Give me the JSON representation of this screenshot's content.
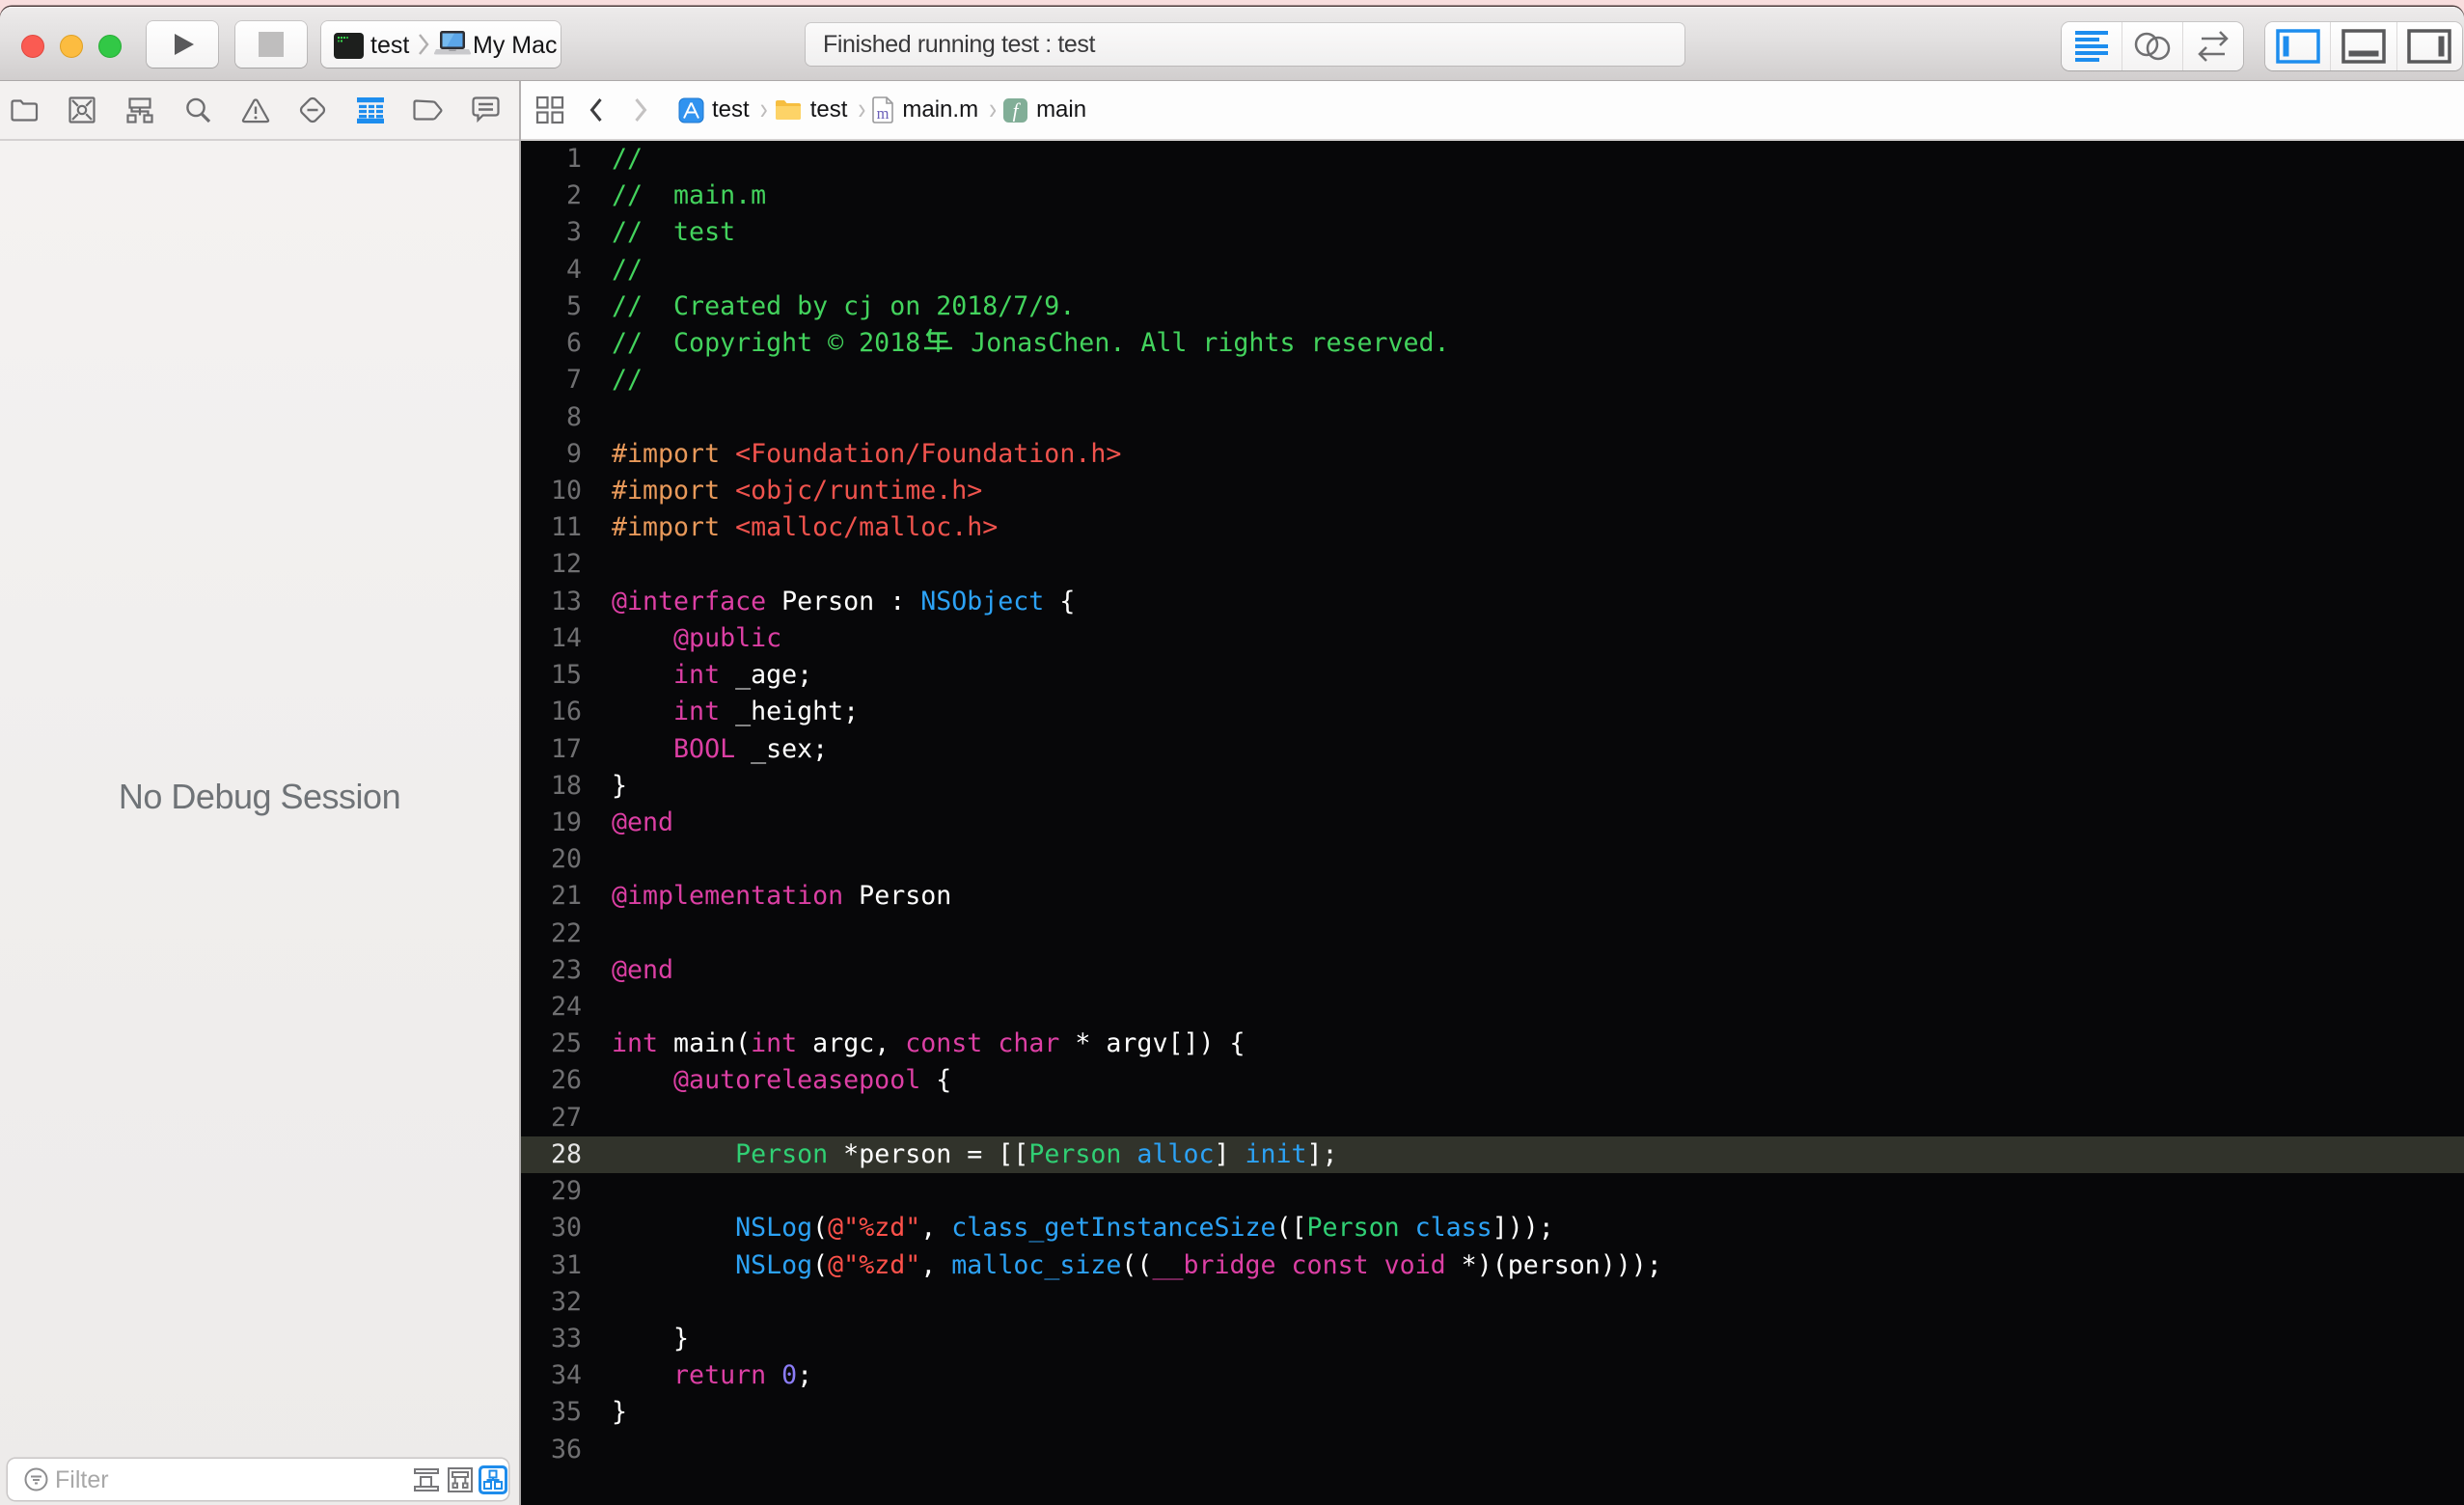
{
  "toolbar": {
    "traffic_lights": [
      "close",
      "minimize",
      "zoom"
    ],
    "run_button": "run",
    "stop_button": "stop",
    "scheme": {
      "name": "test",
      "destination": "My Mac",
      "scheme_icon": "terminal-app-icon",
      "destination_icon": "laptop-icon"
    },
    "status": "Finished running test : test",
    "editor_modes": [
      "standard-editor-icon",
      "assistant-editor-icon",
      "version-editor-icon"
    ],
    "editor_mode_active": 0,
    "panel_toggles": [
      "navigator-panel-icon",
      "debug-area-icon",
      "inspector-panel-icon"
    ],
    "panel_toggles_active": [
      0
    ]
  },
  "navigator_bar": {
    "icons": [
      "project-navigator-icon",
      "source-control-icon",
      "symbol-navigator-icon",
      "find-navigator-icon",
      "issue-navigator-icon",
      "test-navigator-icon",
      "debug-navigator-icon",
      "breakpoint-navigator-icon",
      "report-navigator-icon"
    ],
    "active_index": 6
  },
  "jump_bar": {
    "related_items_icon": "related-items-icon",
    "back": "‹",
    "forward": "›",
    "separator": "›",
    "breadcrumb": [
      {
        "icon": "project-icon",
        "label": "test"
      },
      {
        "icon": "folder-icon",
        "label": "test"
      },
      {
        "icon": "objc-file-icon",
        "label": "main.m"
      },
      {
        "icon": "function-icon",
        "label": "main"
      }
    ]
  },
  "sidebar": {
    "empty_message": "No Debug Session",
    "filter_placeholder": "Filter",
    "filter_icon": "filter-icon",
    "view_buttons": [
      "view-by-thread-icon",
      "view-by-queue-icon",
      "view-hierarchy-icon"
    ],
    "view_buttons_active": 2
  },
  "editor": {
    "language": "objective-c",
    "current_line": 28,
    "colors": {
      "c": "#43D35D",
      "p": "#E8995A",
      "h": "#F0534D",
      "k": "#DC3FA4",
      "t": "#FFFFFF",
      "b": "#2CA2F5",
      "g": "#30D074",
      "s": "#FF514A",
      "n": "#8B7CF6"
    },
    "lines": [
      {
        "n": 1,
        "tokens": [
          [
            "//",
            "c"
          ]
        ]
      },
      {
        "n": 2,
        "tokens": [
          [
            "//  main.m",
            "c"
          ]
        ]
      },
      {
        "n": 3,
        "tokens": [
          [
            "//  test",
            "c"
          ]
        ]
      },
      {
        "n": 4,
        "tokens": [
          [
            "//",
            "c"
          ]
        ]
      },
      {
        "n": 5,
        "tokens": [
          [
            "//  Created by cj on 2018/7/9.",
            "c"
          ]
        ]
      },
      {
        "n": 6,
        "tokens": [
          [
            "//  Copyright © 2018年 JonasChen. All rights reserved.",
            "c"
          ]
        ]
      },
      {
        "n": 7,
        "tokens": [
          [
            "//",
            "c"
          ]
        ]
      },
      {
        "n": 8,
        "tokens": []
      },
      {
        "n": 9,
        "tokens": [
          [
            "#import",
            "p"
          ],
          [
            " ",
            "t"
          ],
          [
            "<Foundation/Foundation.h>",
            "h"
          ]
        ]
      },
      {
        "n": 10,
        "tokens": [
          [
            "#import",
            "p"
          ],
          [
            " ",
            "t"
          ],
          [
            "<objc/runtime.h>",
            "h"
          ]
        ]
      },
      {
        "n": 11,
        "tokens": [
          [
            "#import",
            "p"
          ],
          [
            " ",
            "t"
          ],
          [
            "<malloc/malloc.h>",
            "h"
          ]
        ]
      },
      {
        "n": 12,
        "tokens": []
      },
      {
        "n": 13,
        "tokens": [
          [
            "@interface",
            "k"
          ],
          [
            " Person : ",
            "t"
          ],
          [
            "NSObject",
            "b"
          ],
          [
            " {",
            "t"
          ]
        ]
      },
      {
        "n": 14,
        "tokens": [
          [
            "    ",
            "t"
          ],
          [
            "@public",
            "k"
          ]
        ]
      },
      {
        "n": 15,
        "tokens": [
          [
            "    ",
            "t"
          ],
          [
            "int",
            "k"
          ],
          [
            " _age;",
            "t"
          ]
        ]
      },
      {
        "n": 16,
        "tokens": [
          [
            "    ",
            "t"
          ],
          [
            "int",
            "k"
          ],
          [
            " _height;",
            "t"
          ]
        ]
      },
      {
        "n": 17,
        "tokens": [
          [
            "    ",
            "t"
          ],
          [
            "BOOL",
            "k"
          ],
          [
            " _sex;",
            "t"
          ]
        ]
      },
      {
        "n": 18,
        "tokens": [
          [
            "}",
            "t"
          ]
        ]
      },
      {
        "n": 19,
        "tokens": [
          [
            "@end",
            "k"
          ]
        ]
      },
      {
        "n": 20,
        "tokens": []
      },
      {
        "n": 21,
        "tokens": [
          [
            "@implementation",
            "k"
          ],
          [
            " Person",
            "t"
          ]
        ]
      },
      {
        "n": 22,
        "tokens": []
      },
      {
        "n": 23,
        "tokens": [
          [
            "@end",
            "k"
          ]
        ]
      },
      {
        "n": 24,
        "tokens": []
      },
      {
        "n": 25,
        "tokens": [
          [
            "int",
            "k"
          ],
          [
            " main(",
            "t"
          ],
          [
            "int",
            "k"
          ],
          [
            " argc, ",
            "t"
          ],
          [
            "const",
            "k"
          ],
          [
            " ",
            "t"
          ],
          [
            "char",
            "k"
          ],
          [
            " * argv[]) {",
            "t"
          ]
        ]
      },
      {
        "n": 26,
        "tokens": [
          [
            "    ",
            "t"
          ],
          [
            "@autoreleasepool",
            "k"
          ],
          [
            " {",
            "t"
          ]
        ]
      },
      {
        "n": 27,
        "tokens": []
      },
      {
        "n": 28,
        "tokens": [
          [
            "        ",
            "t"
          ],
          [
            "Person",
            "g"
          ],
          [
            " *person = [[",
            "t"
          ],
          [
            "Person",
            "g"
          ],
          [
            " ",
            "t"
          ],
          [
            "alloc",
            "b"
          ],
          [
            "] ",
            "t"
          ],
          [
            "init",
            "b"
          ],
          [
            "];",
            "t"
          ]
        ]
      },
      {
        "n": 29,
        "tokens": []
      },
      {
        "n": 30,
        "tokens": [
          [
            "        ",
            "t"
          ],
          [
            "NSLog",
            "b"
          ],
          [
            "(",
            "t"
          ],
          [
            "@\"%zd\"",
            "s"
          ],
          [
            ", ",
            "t"
          ],
          [
            "class_getInstanceSize",
            "b"
          ],
          [
            "([",
            "t"
          ],
          [
            "Person",
            "g"
          ],
          [
            " ",
            "t"
          ],
          [
            "class",
            "b"
          ],
          [
            "]));",
            "t"
          ]
        ]
      },
      {
        "n": 31,
        "tokens": [
          [
            "        ",
            "t"
          ],
          [
            "NSLog",
            "b"
          ],
          [
            "(",
            "t"
          ],
          [
            "@\"%zd\"",
            "s"
          ],
          [
            ", ",
            "t"
          ],
          [
            "malloc_size",
            "b"
          ],
          [
            "((",
            "t"
          ],
          [
            "__bridge",
            "k"
          ],
          [
            " ",
            "t"
          ],
          [
            "const",
            "k"
          ],
          [
            " ",
            "t"
          ],
          [
            "void",
            "k"
          ],
          [
            " *)(person)));",
            "t"
          ]
        ]
      },
      {
        "n": 32,
        "tokens": []
      },
      {
        "n": 33,
        "tokens": [
          [
            "    }",
            "t"
          ]
        ]
      },
      {
        "n": 34,
        "tokens": [
          [
            "    ",
            "t"
          ],
          [
            "return",
            "k"
          ],
          [
            " ",
            "t"
          ],
          [
            "0",
            "n"
          ],
          [
            ";",
            "t"
          ]
        ]
      },
      {
        "n": 35,
        "tokens": [
          [
            "}",
            "t"
          ]
        ]
      },
      {
        "n": 36,
        "tokens": []
      }
    ]
  }
}
